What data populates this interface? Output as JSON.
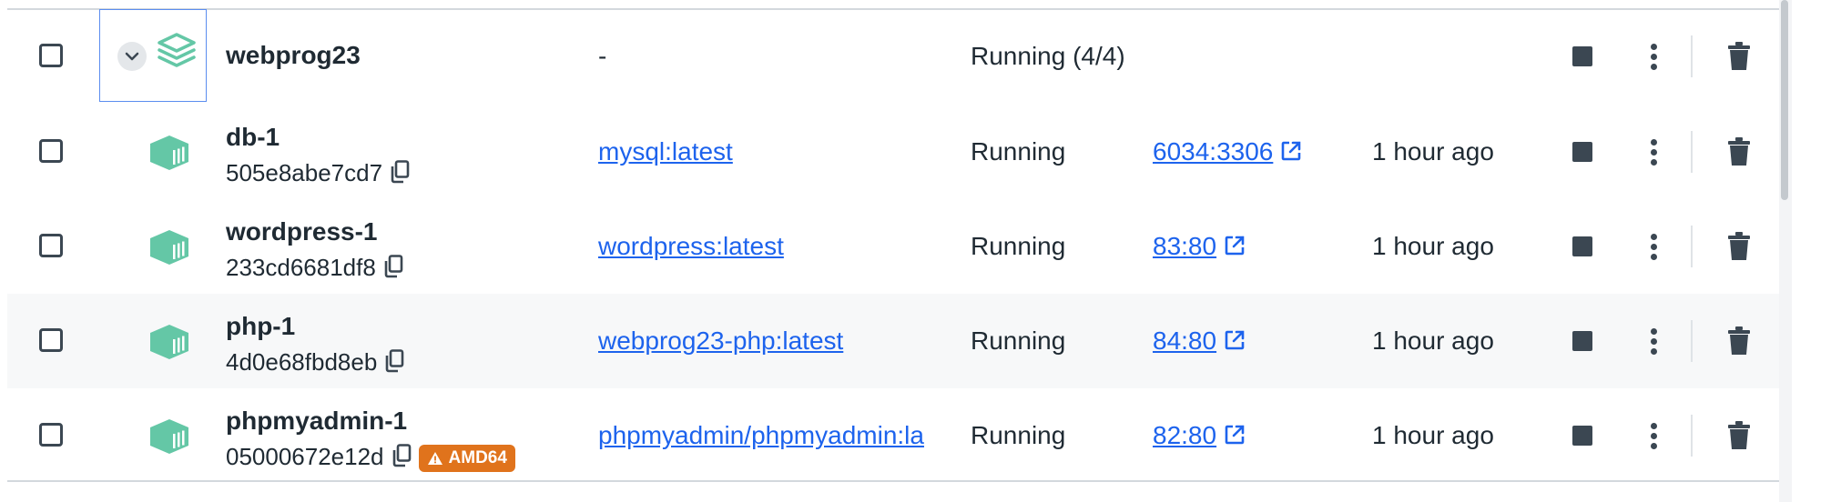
{
  "group": {
    "name": "webprog23",
    "image": "-",
    "status": "Running (4/4)",
    "icon": "stack-layers-icon",
    "icon_color": "#64c7a6"
  },
  "containers": [
    {
      "name": "db-1",
      "id": "505e8abe7cd7",
      "image": "mysql:latest",
      "status": "Running",
      "port": "6034:3306",
      "started": "1 hour ago",
      "badge": ""
    },
    {
      "name": "wordpress-1",
      "id": "233cd6681df8",
      "image": "wordpress:latest",
      "status": "Running",
      "port": "83:80",
      "started": "1 hour ago",
      "badge": ""
    },
    {
      "name": "php-1",
      "id": "4d0e68fbd8eb",
      "image": "webprog23-php:latest",
      "status": "Running",
      "port": "84:80",
      "started": "1 hour ago",
      "badge": ""
    },
    {
      "name": "phpmyadmin-1",
      "id": "05000672e12d",
      "image": "phpmyadmin/phpmyadmin:la",
      "status": "Running",
      "port": "82:80",
      "started": "1 hour ago",
      "badge": "AMD64"
    }
  ],
  "colors": {
    "link": "#1d63ed",
    "container_icon": "#64c7a6",
    "badge_bg": "#e0731c",
    "row_hover": "#f7f8f9"
  },
  "icons": {
    "container": "container-icon",
    "copy": "copy-icon",
    "external": "external-link-icon",
    "stop": "stop-icon",
    "more": "more-vertical-icon",
    "delete": "trash-icon",
    "expand": "chevron-down-icon",
    "warning": "warning-icon"
  }
}
